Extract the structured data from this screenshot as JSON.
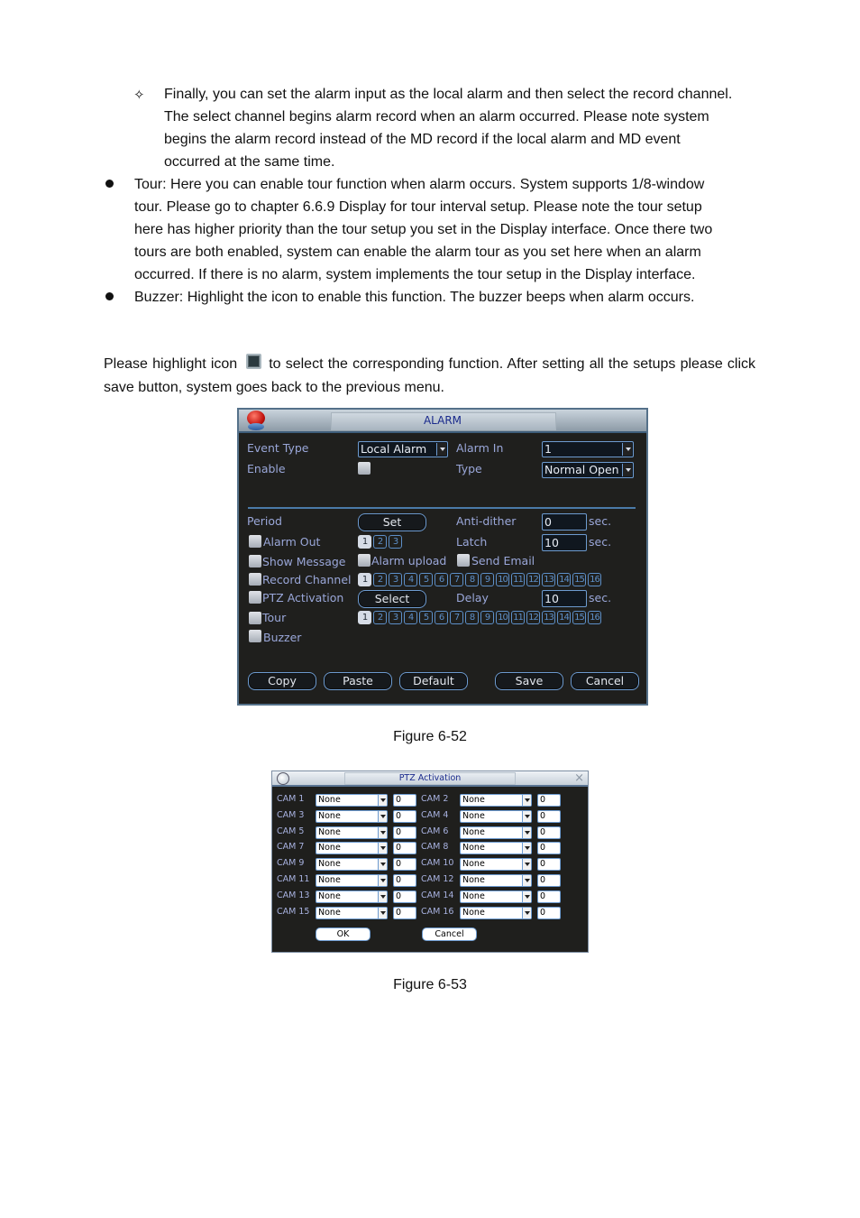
{
  "document": {
    "sub_bullet_glyph": "✧",
    "sub_bullet_lines": [
      "Finally, you can set the alarm input as the local alarm and then select the record channel.",
      "The select channel begins alarm record when an alarm occurred. Please note system",
      "begins the alarm record instead of the MD record if the local alarm and MD event",
      "occurred at the same time."
    ],
    "tour_lines": [
      "Tour: Here you can enable tour function when alarm occurs. System supports 1/8-window",
      "tour. Please go to chapter 6.6.9 Display for tour interval setup. Please note the tour setup",
      "here has higher priority than the tour setup you set in the Display interface. Once there two",
      "tours are both enabled, system can enable the alarm tour as you set here when an alarm",
      "occurred. If there is no alarm, system implements the tour setup in the Display interface."
    ],
    "buzzer_line": "Buzzer: Highlight the icon to enable this function. The buzzer beeps when alarm occurs.",
    "highlight_before": "Please highlight icon",
    "highlight_after": "to select the corresponding function. After setting all the setups please click save button, system goes back to the previous menu.",
    "figure1_caption": "Figure 6-52",
    "figure2_caption": "Figure 6-53"
  },
  "alarm_dialog": {
    "title": "ALARM",
    "event_type_label": "Event Type",
    "event_type_value": "Local Alarm",
    "enable_label": "Enable",
    "alarm_in_label": "Alarm In",
    "alarm_in_value": "1",
    "type_label": "Type",
    "type_value": "Normal Open",
    "period_label": "Period",
    "set_button": "Set",
    "anti_dither_label": "Anti-dither",
    "anti_dither_value": "0",
    "latch_label": "Latch",
    "latch_value": "10",
    "sec_unit": "sec.",
    "alarm_out_label": "Alarm Out",
    "alarm_out_channels": [
      "1",
      "2",
      "3"
    ],
    "alarm_out_selected": [
      "1"
    ],
    "show_message_label": "Show Message",
    "alarm_upload_label": "Alarm upload",
    "send_email_label": "Send Email",
    "record_channel_label": "Record Channel",
    "record_channels": [
      "1",
      "2",
      "3",
      "4",
      "5",
      "6",
      "7",
      "8",
      "9",
      "10",
      "11",
      "12",
      "13",
      "14",
      "15",
      "16"
    ],
    "record_selected": [
      "1"
    ],
    "ptz_activation_label": "PTZ Activation",
    "select_button": "Select",
    "delay_label": "Delay",
    "delay_value": "10",
    "tour_label": "Tour",
    "tour_channels": [
      "1",
      "2",
      "3",
      "4",
      "5",
      "6",
      "7",
      "8",
      "9",
      "10",
      "11",
      "12",
      "13",
      "14",
      "15",
      "16"
    ],
    "tour_selected": [
      "1"
    ],
    "buzzer_label": "Buzzer",
    "buttons": {
      "copy": "Copy",
      "paste": "Paste",
      "default": "Default",
      "save": "Save",
      "cancel": "Cancel"
    }
  },
  "ptz_dialog": {
    "title": "PTZ Activation",
    "close_glyph": "×",
    "cams": [
      {
        "label": "CAM 1",
        "type": "None",
        "value": "0"
      },
      {
        "label": "CAM 2",
        "type": "None",
        "value": "0"
      },
      {
        "label": "CAM 3",
        "type": "None",
        "value": "0"
      },
      {
        "label": "CAM 4",
        "type": "None",
        "value": "0"
      },
      {
        "label": "CAM 5",
        "type": "None",
        "value": "0"
      },
      {
        "label": "CAM 6",
        "type": "None",
        "value": "0"
      },
      {
        "label": "CAM 7",
        "type": "None",
        "value": "0"
      },
      {
        "label": "CAM 8",
        "type": "None",
        "value": "0"
      },
      {
        "label": "CAM 9",
        "type": "None",
        "value": "0"
      },
      {
        "label": "CAM 10",
        "type": "None",
        "value": "0"
      },
      {
        "label": "CAM 11",
        "type": "None",
        "value": "0"
      },
      {
        "label": "CAM 12",
        "type": "None",
        "value": "0"
      },
      {
        "label": "CAM 13",
        "type": "None",
        "value": "0"
      },
      {
        "label": "CAM 14",
        "type": "None",
        "value": "0"
      },
      {
        "label": "CAM 15",
        "type": "None",
        "value": "0"
      },
      {
        "label": "CAM 16",
        "type": "None",
        "value": "0"
      }
    ],
    "ok_button": "OK",
    "cancel_button": "Cancel"
  }
}
